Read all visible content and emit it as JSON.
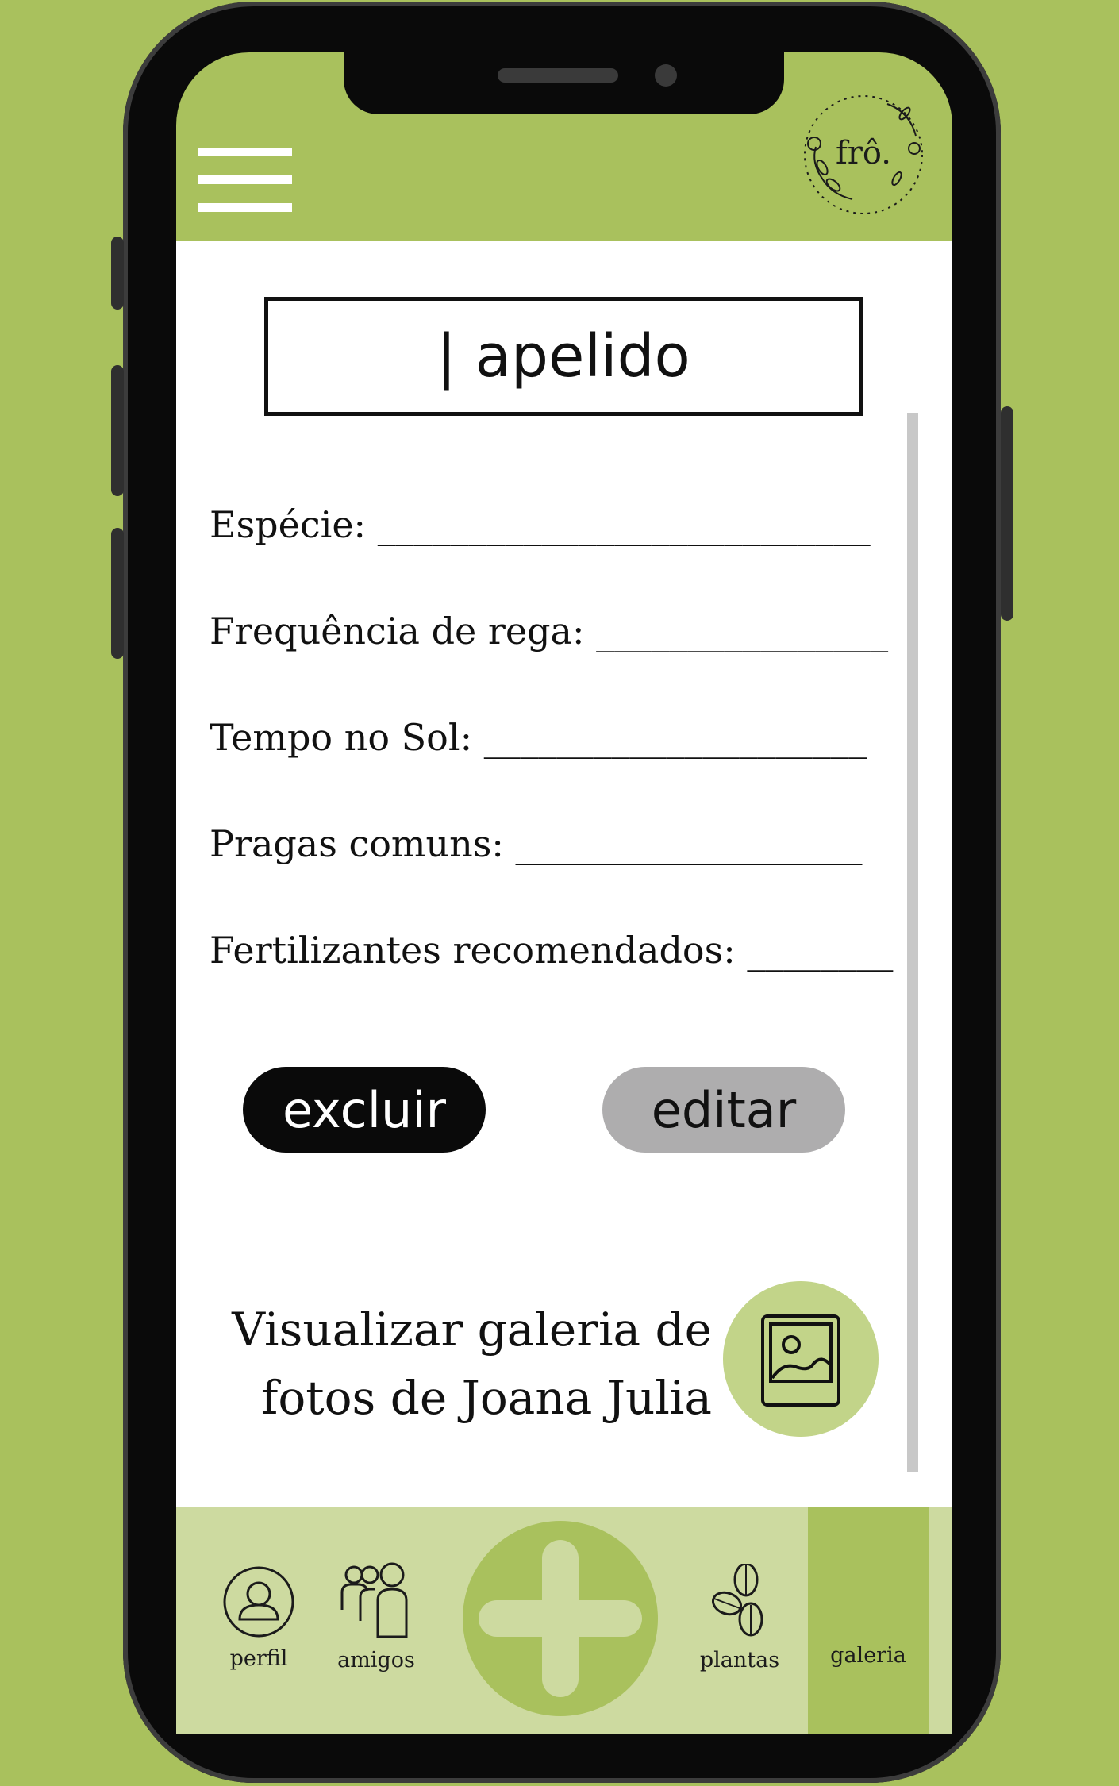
{
  "header": {
    "logo_text": "frô.",
    "menu_icon": "hamburger-menu-icon"
  },
  "plant": {
    "nickname_placeholder": "| apelido",
    "fields": [
      {
        "label": "Espécie:",
        "blank": "___________________________"
      },
      {
        "label": "Frequência de rega:",
        "blank": "________________"
      },
      {
        "label": "Tempo no Sol:",
        "blank": "_____________________"
      },
      {
        "label": "Pragas comuns:",
        "blank": "___________________"
      },
      {
        "label": "Fertilizantes recomendados:",
        "blank": "________"
      }
    ]
  },
  "actions": {
    "delete_label": "excluir",
    "edit_label": "editar"
  },
  "gallery": {
    "line1": "Visualizar galeria de",
    "line2": "fotos de Joana Julia",
    "icon": "photo-icon"
  },
  "nav": {
    "profile_label": "perfil",
    "friends_label": "amigos",
    "plants_label": "plantas",
    "gallery_label": "galeria",
    "add_icon": "plus-icon",
    "active": "galeria"
  },
  "colors": {
    "brand_green": "#a9c15d",
    "light_green": "#cddaa0",
    "gallery_circle": "#c2d489",
    "edit_gray": "#aeadae"
  }
}
